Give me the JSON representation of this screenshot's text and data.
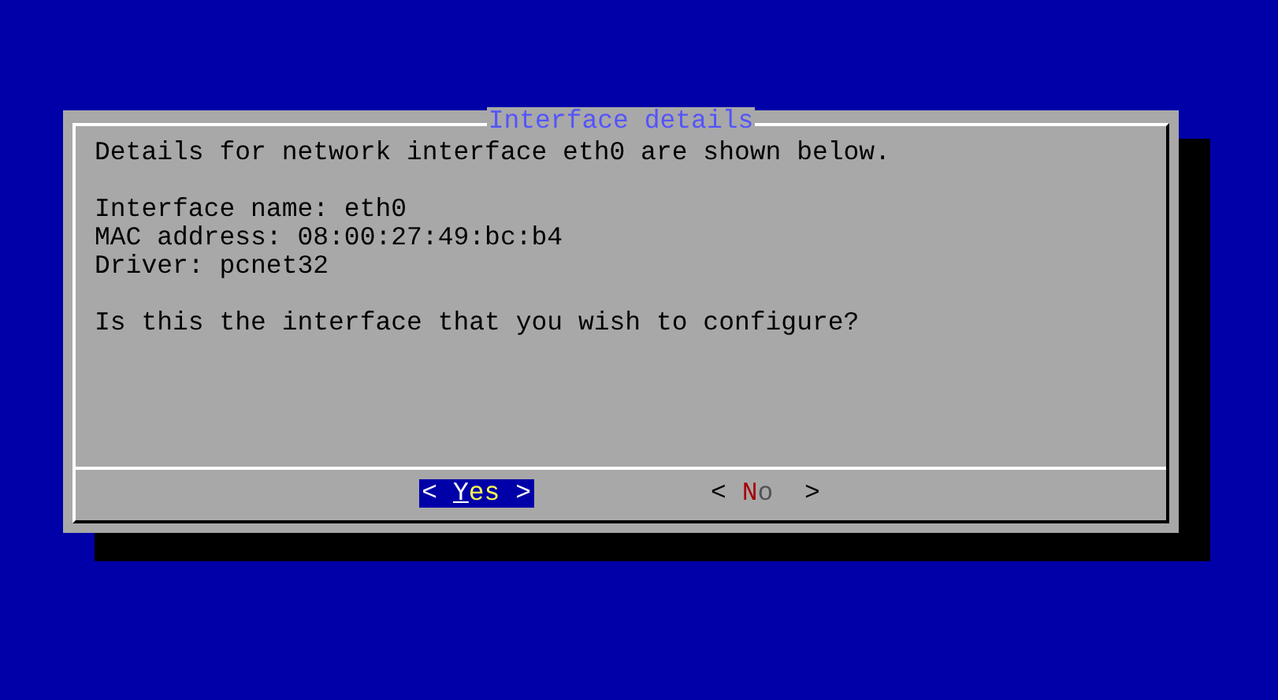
{
  "dialog": {
    "title": "Interface details",
    "paragraphs": [
      [
        "Details for network interface eth0 are shown below."
      ],
      [
        "Interface name: eth0",
        "MAC address: 08:00:27:49:bc:b4",
        "Driver: pcnet32"
      ],
      [
        "Is this the interface that you wish to configure?"
      ]
    ],
    "buttons": [
      {
        "left": "<",
        "label": "Yes",
        "right": ">",
        "selected": true
      },
      {
        "left": "<",
        "label": "No",
        "right": ">",
        "selected": false
      }
    ]
  }
}
